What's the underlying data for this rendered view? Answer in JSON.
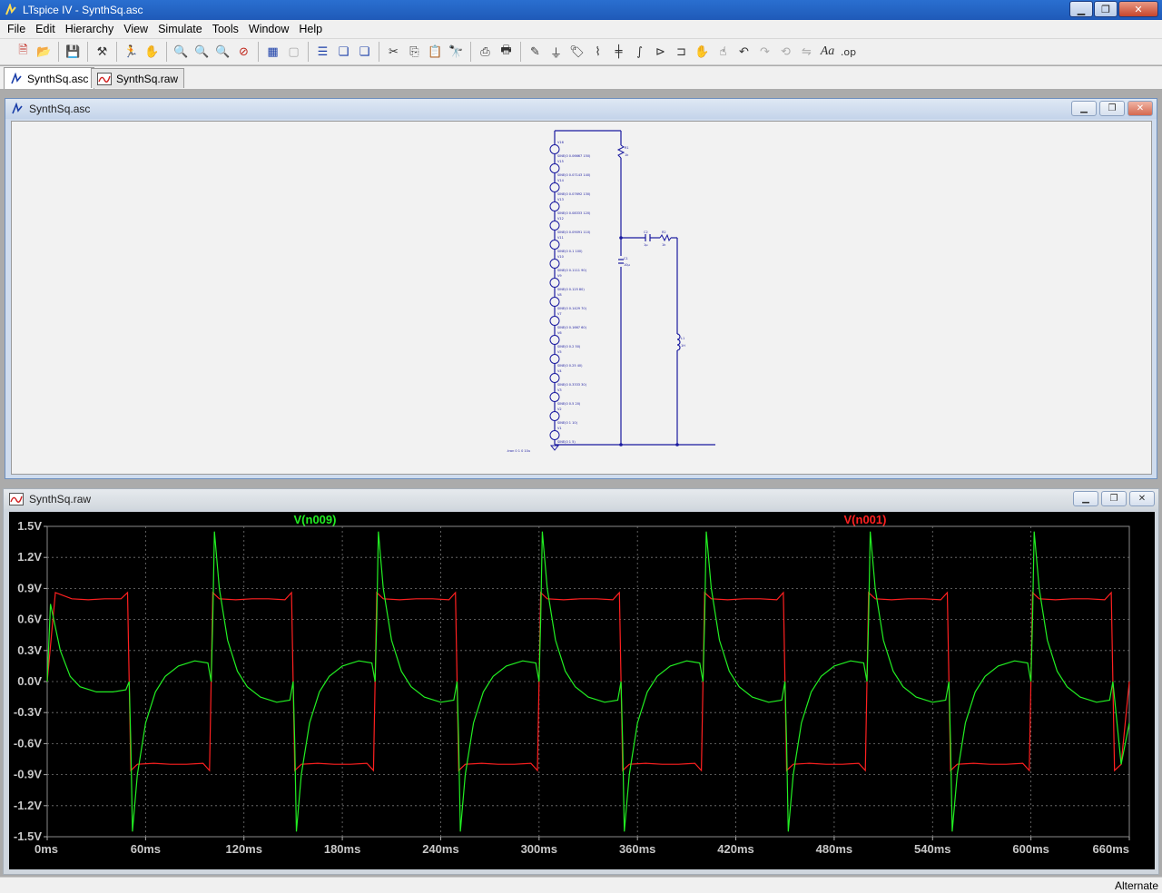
{
  "app": {
    "title": "LTspice IV - SynthSq.asc"
  },
  "menu": {
    "items": [
      "File",
      "Edit",
      "Hierarchy",
      "View",
      "Simulate",
      "Tools",
      "Window",
      "Help"
    ]
  },
  "toolbar": {
    "buttons": [
      "new-schematic",
      "open",
      "save",
      "control-panel",
      "run",
      "halt",
      "zoom-in",
      "zoom-area",
      "zoom-out",
      "zoom-cancel",
      "autoscale",
      "zoom-fit",
      "tile-horizontal",
      "cascade",
      "close-windows",
      "cut",
      "copy",
      "paste",
      "find",
      "print-preview",
      "print",
      "draw-wire",
      "ground",
      "label-net",
      "resistor",
      "capacitor",
      "inductor",
      "diode",
      "component",
      "move",
      "drag",
      "undo",
      "redo",
      "rotate",
      "mirror",
      "text",
      "spice-directive"
    ],
    "text_aa": "Aa",
    "text_op": ".op"
  },
  "tabs": [
    {
      "label": "SynthSq.asc",
      "active": true
    },
    {
      "label": "SynthSq.raw",
      "active": false
    }
  ],
  "schematic_window": {
    "title": "SynthSq.asc",
    "directive": ".tran 0 1 0 10u",
    "sources": [
      {
        "name": "V16",
        "value": "SINE(0 0.06667 150)"
      },
      {
        "name": "V15",
        "value": "SINE(0 0.07143 140)"
      },
      {
        "name": "V14",
        "value": "SINE(0 0.07692 130)"
      },
      {
        "name": "V13",
        "value": "SINE(0 0.08333 120)"
      },
      {
        "name": "V12",
        "value": "SINE(0 0.09091 110)"
      },
      {
        "name": "V11",
        "value": "SINE(0 0.1 100)"
      },
      {
        "name": "V10",
        "value": "SINE(0 0.1111 90)"
      },
      {
        "name": "V9",
        "value": "SINE(0 0.125 80)"
      },
      {
        "name": "V8",
        "value": "SINE(0 0.1429 70)"
      },
      {
        "name": "V7",
        "value": "SINE(0 0.1667 60)"
      },
      {
        "name": "V6",
        "value": "SINE(0 0.2 50)"
      },
      {
        "name": "V5",
        "value": "SINE(0 0.25 40)"
      },
      {
        "name": "V4",
        "value": "SINE(0 0.3333 30)"
      },
      {
        "name": "V3",
        "value": "SINE(0 0.5 20)"
      },
      {
        "name": "V2",
        "value": "SINE(0 1 10)"
      },
      {
        "name": "V1",
        "value": "SINE(0 1 5)"
      }
    ],
    "components": [
      {
        "name": "R1",
        "value": "1k"
      },
      {
        "name": "C1",
        "value": "10µ"
      },
      {
        "name": "C2",
        "value": "1µ"
      },
      {
        "name": "R2",
        "value": "1k"
      },
      {
        "name": "L1",
        "value": "1H"
      }
    ]
  },
  "waveform_window": {
    "title": "SynthSq.raw",
    "traces": [
      {
        "label": "V(n009)",
        "color": "#22ee22"
      },
      {
        "label": "V(n001)",
        "color": "#ff2020"
      }
    ],
    "yticks": [
      "1.5V",
      "1.2V",
      "0.9V",
      "0.6V",
      "0.3V",
      "0.0V",
      "-0.3V",
      "-0.6V",
      "-0.9V",
      "-1.2V",
      "-1.5V"
    ],
    "xticks": [
      "0ms",
      "60ms",
      "120ms",
      "180ms",
      "240ms",
      "300ms",
      "360ms",
      "420ms",
      "480ms",
      "540ms",
      "600ms",
      "660ms"
    ]
  },
  "chart_data": {
    "type": "line",
    "title": "",
    "xlabel": "",
    "ylabel": "",
    "xlim": [
      0,
      660
    ],
    "ylim": [
      -1.5,
      1.5
    ],
    "x_unit": "ms",
    "y_unit": "V",
    "grid": true,
    "series": [
      {
        "name": "V(n001)",
        "color": "#ff2020",
        "x": [
          0,
          5,
          15,
          25,
          35,
          45,
          49,
          50,
          51,
          55,
          65,
          75,
          85,
          95,
          99,
          100,
          101,
          105,
          115,
          125,
          135,
          145,
          149,
          150,
          151,
          155,
          165,
          175,
          185,
          195,
          199,
          200,
          201,
          205,
          215,
          225,
          235,
          245,
          249,
          250,
          251,
          255,
          265,
          275,
          285,
          295,
          299,
          300,
          301,
          305,
          315,
          325,
          335,
          345,
          349,
          350,
          351,
          355,
          365,
          375,
          385,
          395,
          399,
          400,
          401,
          405,
          415,
          425,
          435,
          445,
          449,
          450,
          451,
          455,
          465,
          475,
          485,
          495,
          499,
          500,
          501,
          505,
          515,
          525,
          535,
          545,
          549,
          550,
          551,
          555,
          565,
          575,
          585,
          595,
          599,
          600,
          601,
          605,
          615,
          625,
          635,
          645,
          649,
          650,
          651,
          655,
          660
        ],
        "y": [
          0,
          0.86,
          0.8,
          0.79,
          0.8,
          0.8,
          0.86,
          0,
          -0.86,
          -0.8,
          -0.79,
          -0.8,
          -0.8,
          -0.79,
          -0.86,
          0,
          0.86,
          0.8,
          0.79,
          0.8,
          0.8,
          0.79,
          0.86,
          0,
          -0.86,
          -0.8,
          -0.79,
          -0.8,
          -0.8,
          -0.79,
          -0.86,
          0,
          0.86,
          0.8,
          0.79,
          0.8,
          0.8,
          0.79,
          0.86,
          0,
          -0.86,
          -0.8,
          -0.79,
          -0.8,
          -0.8,
          -0.79,
          -0.86,
          0,
          0.86,
          0.8,
          0.79,
          0.8,
          0.8,
          0.79,
          0.86,
          0,
          -0.86,
          -0.8,
          -0.79,
          -0.8,
          -0.8,
          -0.79,
          -0.86,
          0,
          0.86,
          0.8,
          0.79,
          0.8,
          0.8,
          0.79,
          0.86,
          0,
          -0.86,
          -0.8,
          -0.79,
          -0.8,
          -0.8,
          -0.79,
          -0.86,
          0,
          0.86,
          0.8,
          0.79,
          0.8,
          0.8,
          0.79,
          0.86,
          0,
          -0.86,
          -0.8,
          -0.79,
          -0.8,
          -0.8,
          -0.79,
          -0.86,
          0,
          0.86,
          0.8,
          0.79,
          0.8,
          0.8,
          0.79,
          0.86,
          0,
          -0.86,
          -0.8,
          0
        ]
      },
      {
        "name": "V(n009)",
        "color": "#22ee22",
        "x": [
          0,
          2,
          8,
          14,
          20,
          30,
          40,
          48,
          50,
          51,
          52,
          55,
          60,
          66,
          72,
          80,
          90,
          98,
          100,
          101,
          102,
          105,
          110,
          116,
          122,
          130,
          140,
          148,
          150,
          151,
          152,
          155,
          160,
          166,
          172,
          180,
          190,
          198,
          200,
          201,
          202,
          205,
          210,
          216,
          222,
          230,
          240,
          248,
          250,
          251,
          252,
          255,
          260,
          266,
          272,
          280,
          290,
          298,
          300,
          301,
          302,
          305,
          310,
          316,
          322,
          330,
          340,
          348,
          350,
          351,
          352,
          355,
          360,
          366,
          372,
          380,
          390,
          398,
          400,
          401,
          402,
          405,
          410,
          416,
          422,
          430,
          440,
          448,
          450,
          451,
          452,
          455,
          460,
          466,
          472,
          480,
          490,
          498,
          500,
          501,
          502,
          505,
          510,
          516,
          522,
          530,
          540,
          548,
          550,
          551,
          552,
          555,
          560,
          566,
          572,
          580,
          590,
          598,
          600,
          601,
          602,
          605,
          610,
          616,
          622,
          630,
          640,
          648,
          650,
          655,
          660
        ],
        "y": [
          0,
          0.75,
          0.3,
          0.05,
          -0.05,
          -0.1,
          -0.1,
          -0.08,
          0,
          -0.6,
          -1.45,
          -0.9,
          -0.4,
          -0.1,
          0.05,
          0.15,
          0.2,
          0.18,
          0,
          0.6,
          1.45,
          0.9,
          0.4,
          0.1,
          -0.05,
          -0.15,
          -0.2,
          -0.18,
          0,
          -0.6,
          -1.45,
          -0.9,
          -0.4,
          -0.1,
          0.05,
          0.15,
          0.2,
          0.18,
          0,
          0.6,
          1.45,
          0.9,
          0.4,
          0.1,
          -0.05,
          -0.15,
          -0.2,
          -0.18,
          0,
          -0.6,
          -1.45,
          -0.9,
          -0.4,
          -0.1,
          0.05,
          0.15,
          0.2,
          0.18,
          0,
          0.6,
          1.45,
          0.9,
          0.4,
          0.1,
          -0.05,
          -0.15,
          -0.2,
          -0.18,
          0,
          -0.6,
          -1.45,
          -0.9,
          -0.4,
          -0.1,
          0.05,
          0.15,
          0.2,
          0.18,
          0,
          0.6,
          1.45,
          0.9,
          0.4,
          0.1,
          -0.05,
          -0.15,
          -0.2,
          -0.18,
          0,
          -0.6,
          -1.45,
          -0.9,
          -0.4,
          -0.1,
          0.05,
          0.15,
          0.2,
          0.18,
          0,
          0.6,
          1.45,
          0.9,
          0.4,
          0.1,
          -0.05,
          -0.15,
          -0.2,
          -0.18,
          0,
          -0.6,
          -1.45,
          -0.9,
          -0.4,
          -0.1,
          0.05,
          0.15,
          0.2,
          0.18,
          0,
          0.6,
          1.45,
          0.9,
          0.4,
          0.1,
          -0.05,
          -0.15,
          -0.2,
          -0.18,
          0,
          -0.8,
          -0.4
        ]
      }
    ]
  },
  "status": {
    "text": "Alternate"
  }
}
